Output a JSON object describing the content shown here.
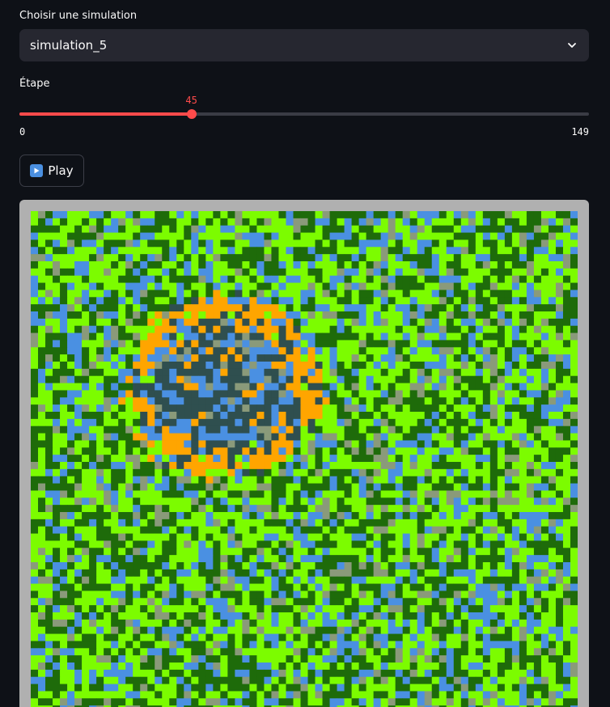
{
  "simulation_select": {
    "label": "Choisir une simulation",
    "value": "simulation_5",
    "icon": "chevron-down-icon"
  },
  "step_slider": {
    "label": "Étape",
    "min": 0,
    "max": 149,
    "value": 45,
    "min_label": "0",
    "max_label": "149",
    "value_label": "45",
    "accent_color": "#ff4b4b"
  },
  "play_button": {
    "label": "Play",
    "icon": "play-icon"
  },
  "simulation_grid": {
    "columns": 75,
    "rows": 70,
    "colors": {
      "tree_light": "#7cfc00",
      "tree_dark": "#1e6b0a",
      "water": "#4a90e2",
      "empty": "#8a9a7a",
      "burning": "#ffa500",
      "burnt": "#2f4f4f",
      "border": "#b0b0b0"
    }
  }
}
